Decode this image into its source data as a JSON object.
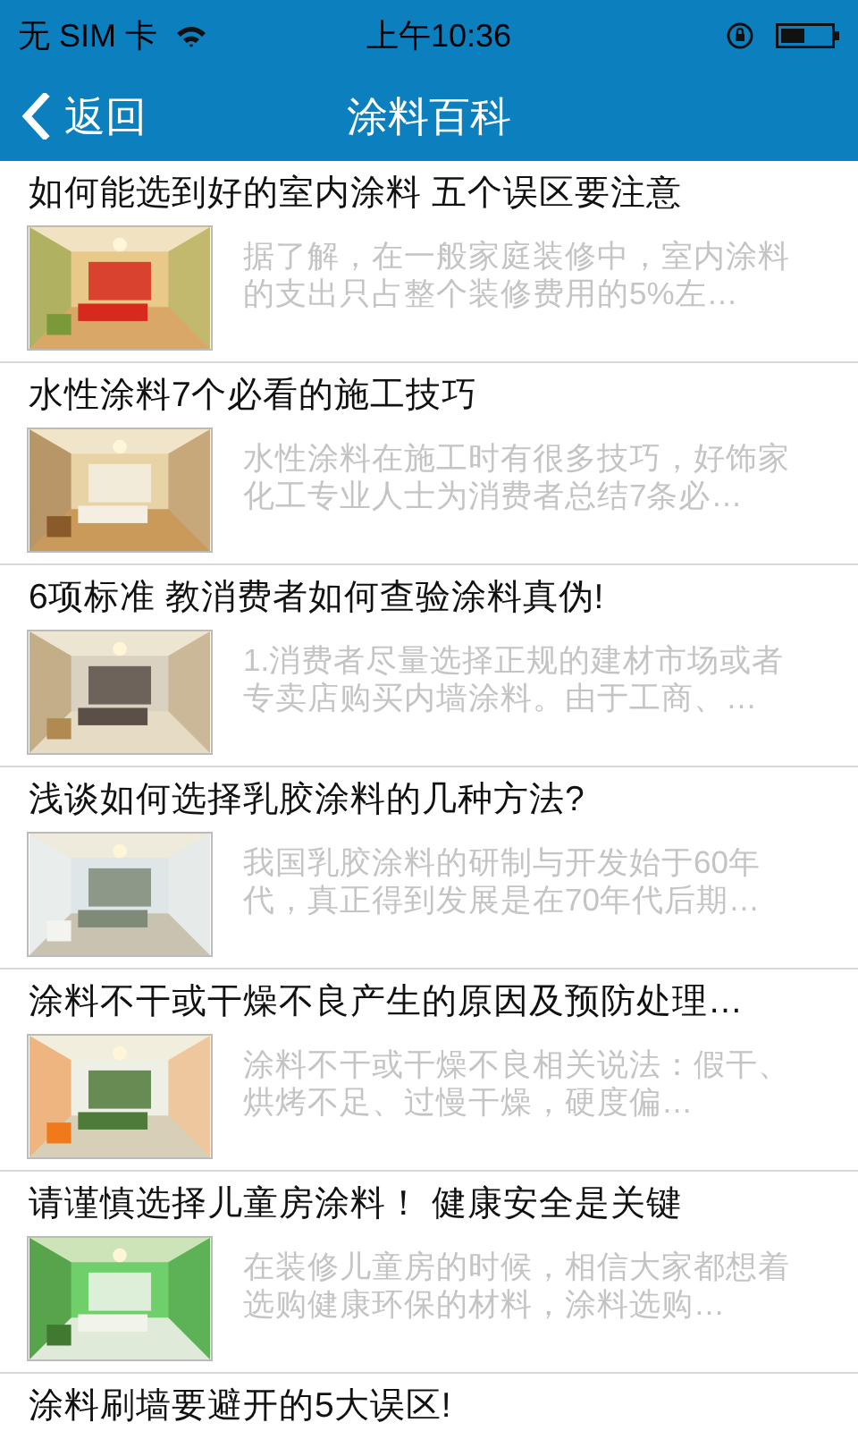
{
  "status_bar": {
    "carrier": "无 SIM 卡",
    "time": "上午10:36"
  },
  "nav": {
    "back": "返回",
    "title": "涂料百科"
  },
  "articles": [
    {
      "title": "如何能选到好的室内涂料 五个误区要注意",
      "summary": "据了解，在一般家庭装修中，室内涂料的支出只占整个装修费用的5%左…"
    },
    {
      "title": "水性涂料7个必看的施工技巧",
      "summary": "水性涂料在施工时有很多技巧，好饰家化工专业人士为消费者总结7条必…"
    },
    {
      "title": "6项标准 教消费者如何查验涂料真伪!",
      "summary": "1.消费者尽量选择正规的建材市场或者专卖店购买内墙涂料。由于工商、…"
    },
    {
      "title": "浅谈如何选择乳胶涂料的几种方法?",
      "summary": "我国乳胶涂料的研制与开发始于60年代，真正得到发展是在70年代后期…"
    },
    {
      "title": "涂料不干或干燥不良产生的原因及预防处理…",
      "summary": "涂料不干或干燥不良相关说法：假干、烘烤不足、过慢干燥，硬度偏…"
    },
    {
      "title": "请谨慎选择儿童房涂料！ 健康安全是关键",
      "summary": "在装修儿童房的时候，相信大家都想着选购健康环保的材料，涂料选购…"
    },
    {
      "title": "涂料刷墙要避开的5大误区!"
    }
  ]
}
